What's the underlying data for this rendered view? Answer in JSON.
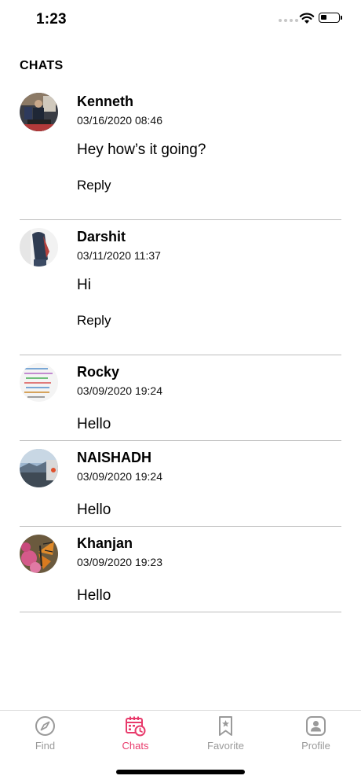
{
  "status": {
    "time": "1:23",
    "battery_level": 0.35
  },
  "header": {
    "title": "CHATS"
  },
  "chats": [
    {
      "name": "Kenneth",
      "date": "03/16/2020 08:46",
      "message": "Hey how’s it going?",
      "reply": "Reply"
    },
    {
      "name": "Darshit",
      "date": "03/11/2020 11:37",
      "message": "Hi",
      "reply": "Reply"
    },
    {
      "name": "Rocky",
      "date": "03/09/2020 19:24",
      "message": "Hello"
    },
    {
      "name": "NAISHADH",
      "date": "03/09/2020 19:24",
      "message": "Hello"
    },
    {
      "name": "Khanjan",
      "date": "03/09/2020 19:23",
      "message": "Hello"
    }
  ],
  "tabs": [
    {
      "label": "Find",
      "icon": "compass-icon"
    },
    {
      "label": "Chats",
      "icon": "calendar-clock-icon",
      "active": true
    },
    {
      "label": "Favorite",
      "icon": "bookmark-star-icon"
    },
    {
      "label": "Profile",
      "icon": "profile-icon"
    }
  ],
  "colors": {
    "accent": "#e83a6b",
    "inactive": "#9a9a9a",
    "divider": "#bdbdbd"
  }
}
